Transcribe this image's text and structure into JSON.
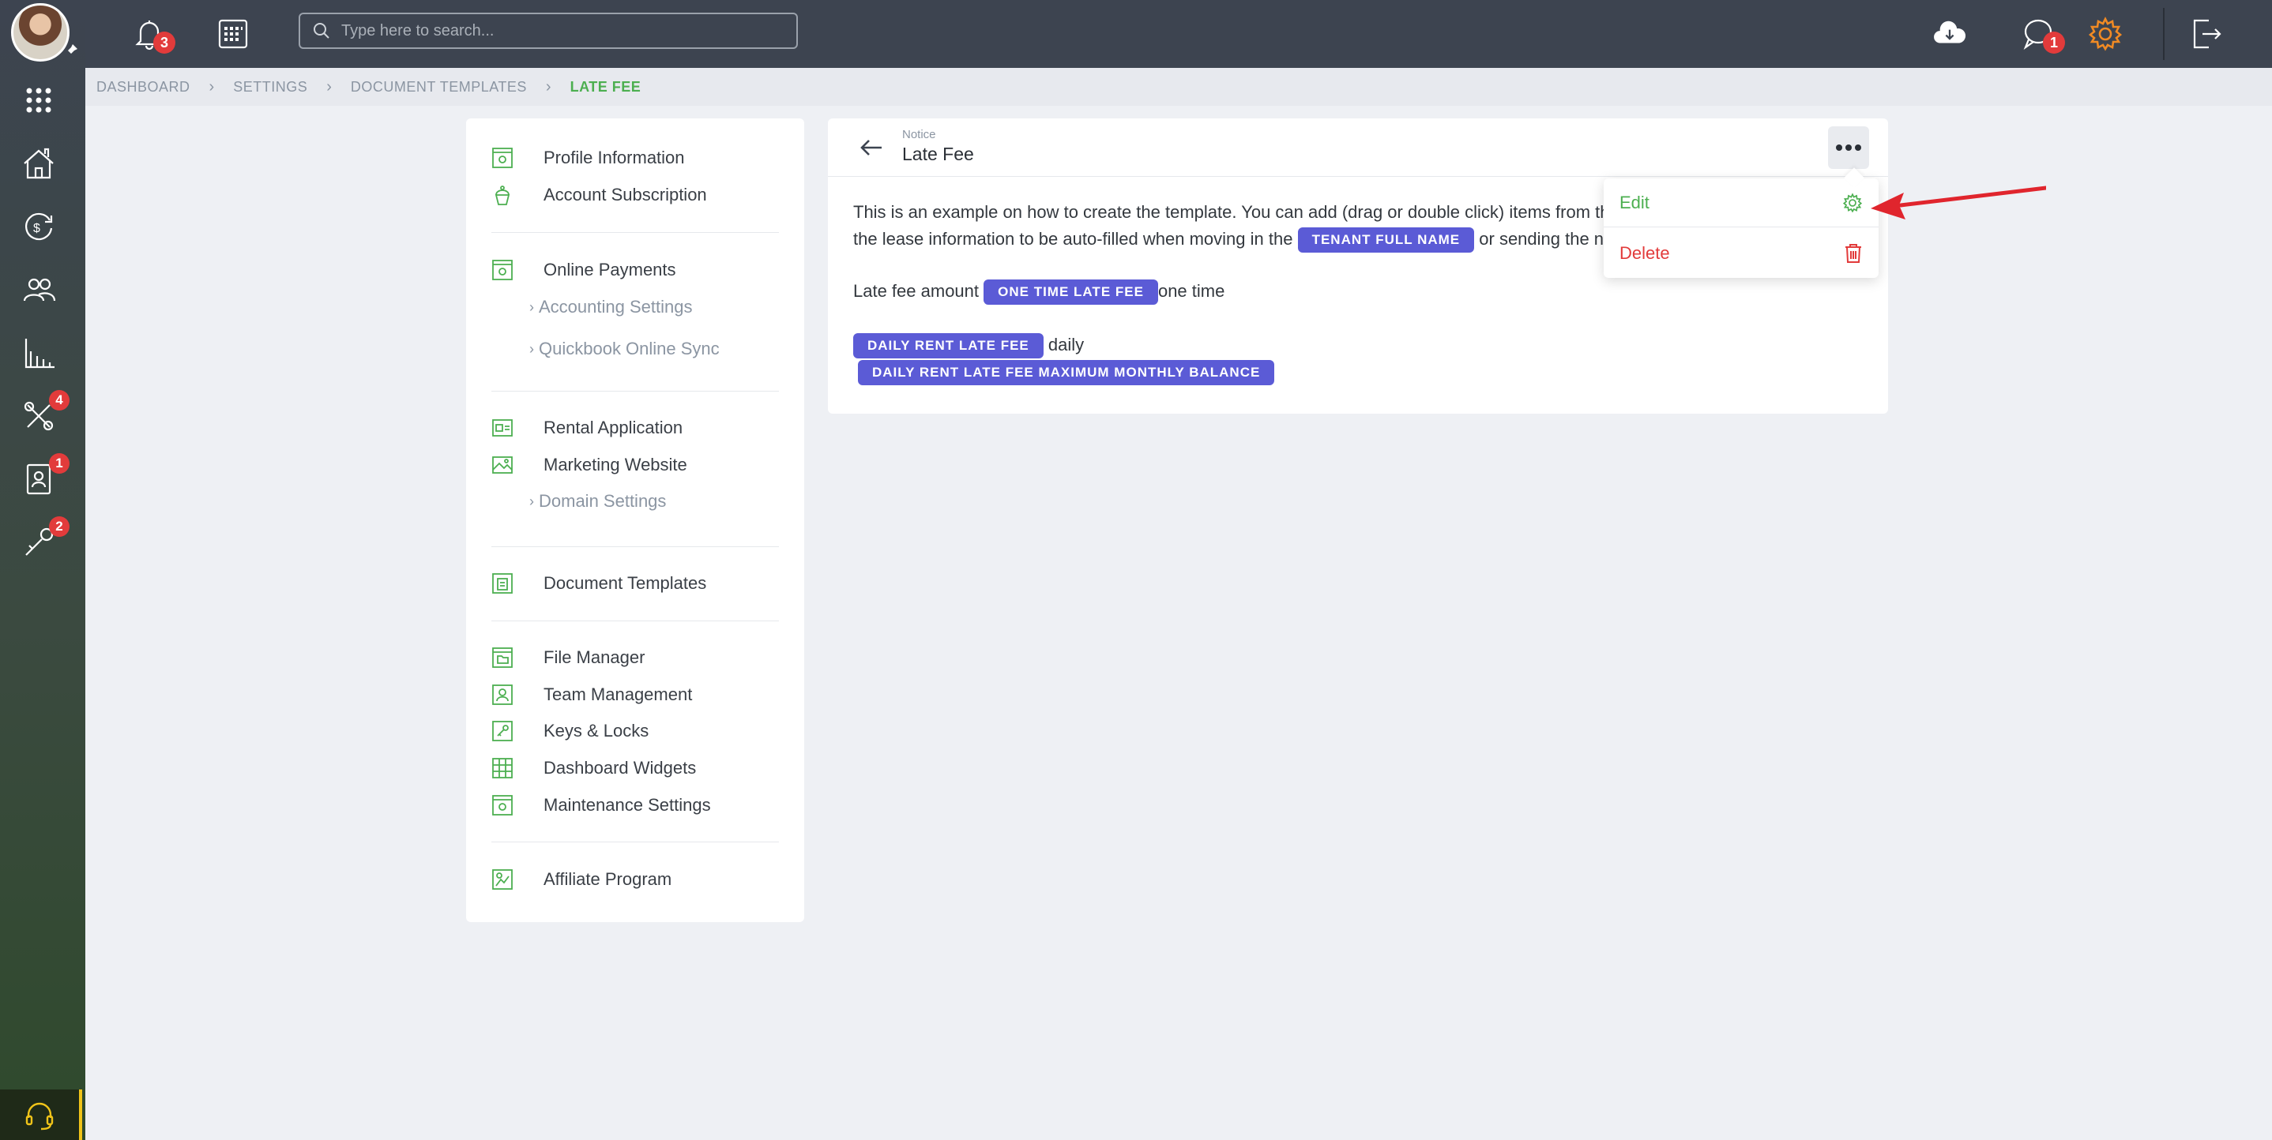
{
  "topbar": {
    "notifications_count": "3",
    "search_placeholder": "Type here to search...",
    "messages_count": "1"
  },
  "rail": {
    "badges": {
      "maintenance": "4",
      "tenants": "1",
      "tools": "2"
    }
  },
  "breadcrumb": [
    "DASHBOARD",
    "SETTINGS",
    "DOCUMENT TEMPLATES",
    "LATE FEE"
  ],
  "settings_menu": {
    "profile_information": "Profile Information",
    "account_subscription": "Account Subscription",
    "online_payments": "Online Payments",
    "accounting_settings": "Accounting Settings",
    "quickbook_online_sync": "Quickbook Online Sync",
    "rental_application": "Rental Application",
    "marketing_website": "Marketing Website",
    "domain_settings": "Domain Settings",
    "document_templates": "Document Templates",
    "file_manager": "File Manager",
    "team_management": "Team Management",
    "keys_locks": "Keys & Locks",
    "dashboard_widgets": "Dashboard Widgets",
    "maintenance_settings": "Maintenance Settings",
    "affiliate_program": "Affiliate Program"
  },
  "notice": {
    "type_label": "Notice",
    "title": "Late Fee",
    "line1": "This is an example on how to create the template. You can add (drag or double click) items from the",
    "line2_before": "the lease information to be auto-filled when moving in the",
    "line2_after": "or sending the no",
    "chip_tenant_full_name": "TENANT FULL NAME",
    "late_fee_amount_label": "Late fee amount",
    "chip_one_time_late_fee": "ONE TIME LATE FEE",
    "one_time_text": "one time",
    "chip_daily_rent_late_fee": "DAILY RENT LATE FEE",
    "daily_text": "daily",
    "chip_daily_rent_max": "DAILY RENT LATE FEE MAXIMUM MONTHLY BALANCE"
  },
  "dropdown": {
    "edit_label": "Edit",
    "delete_label": "Delete"
  },
  "colors": {
    "topbar": "#3d4450",
    "accent_green": "#4caf50",
    "chip_purple": "#5b5bd6",
    "danger_red": "#e23b3b",
    "settings_orange": "#f08a24"
  }
}
